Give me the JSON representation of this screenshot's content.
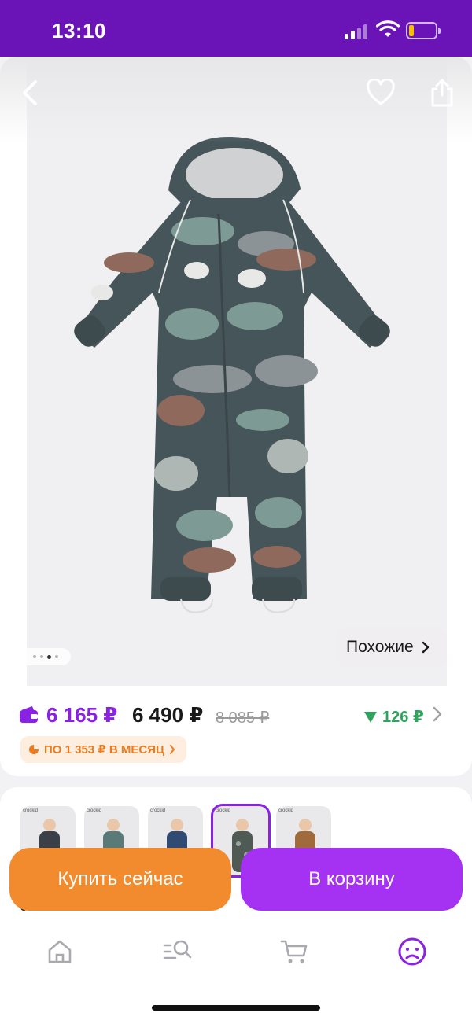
{
  "status_bar": {
    "time": "13:10"
  },
  "hero": {
    "similar_label": "Похожие",
    "page_dots_count": 4,
    "active_dot": 3
  },
  "price": {
    "card_price": "6 165 ₽",
    "regular_price": "6 490 ₽",
    "old_price": "8 085 ₽",
    "cashback": "126 ₽",
    "installment": "ПО 1 353 ₽ В МЕСЯЦ"
  },
  "variants": {
    "items": [
      {
        "tag": "crockid",
        "color": "#3b3f48"
      },
      {
        "tag": "crockid",
        "color": "#5a7a78"
      },
      {
        "tag": "crockid",
        "color": "#2f4a73"
      },
      {
        "tag": "crockid",
        "color": "#4f5a55"
      },
      {
        "tag": "crockid",
        "color": "#a06a3c"
      }
    ],
    "selected_index": 3,
    "color_label": "зеленый"
  },
  "actions": {
    "buy_now": "Купить сейчас",
    "add_to_cart": "В корзину"
  },
  "tabbar": {
    "items": [
      {
        "icon": "home-icon"
      },
      {
        "icon": "catalog-search-icon"
      },
      {
        "icon": "cart-icon"
      },
      {
        "icon": "profile-icon"
      }
    ],
    "active_index": 3
  },
  "colors": {
    "status_bar": "#6a14b8",
    "brand_purple": "#8a22e6",
    "buy_orange": "#f28a2e",
    "cart_purple": "#a531f3",
    "cashback_green": "#2ea35c"
  }
}
